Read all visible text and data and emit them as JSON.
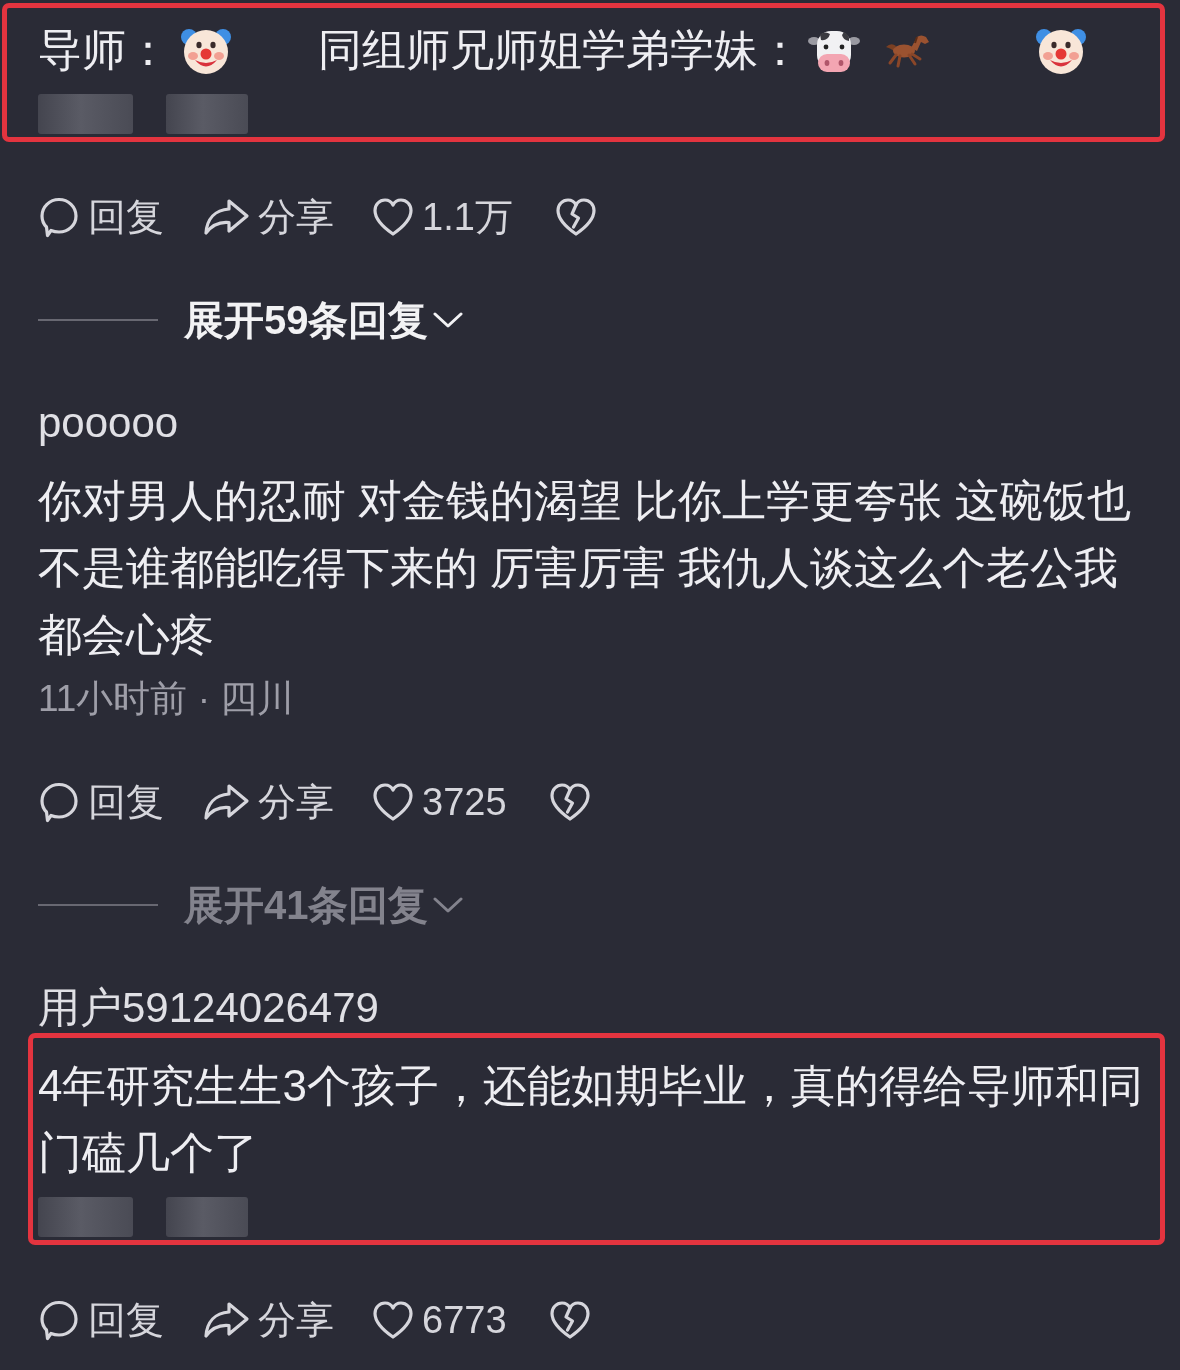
{
  "comments": [
    {
      "highlighted": true,
      "body_parts": [
        "导师：",
        "同组师兄师姐学弟学妹："
      ],
      "meta_redacted": true,
      "actions": {
        "reply": "回复",
        "share": "分享",
        "likes": "1.1万"
      },
      "replies": {
        "label": "展开59条回复",
        "dimmed": false
      }
    },
    {
      "username": "pooooo",
      "highlighted": false,
      "body": "你对男人的忍耐 对金钱的渴望 比你上学更夸张 这碗饭也不是谁都能吃得下来的 厉害厉害 我仇人谈这么个老公我都会心疼",
      "meta_redacted": false,
      "meta": "11小时前 · 四川",
      "actions": {
        "reply": "回复",
        "share": "分享",
        "likes": "3725"
      },
      "replies": {
        "label": "展开41条回复",
        "dimmed": true
      }
    },
    {
      "username": "用户59124026479",
      "highlighted": true,
      "body": "4年研究生生3个孩子，还能如期毕业，真的得给导师和同门磕几个了",
      "meta_redacted": true,
      "actions": {
        "reply": "回复",
        "share": "分享",
        "likes": "6773"
      }
    }
  ]
}
